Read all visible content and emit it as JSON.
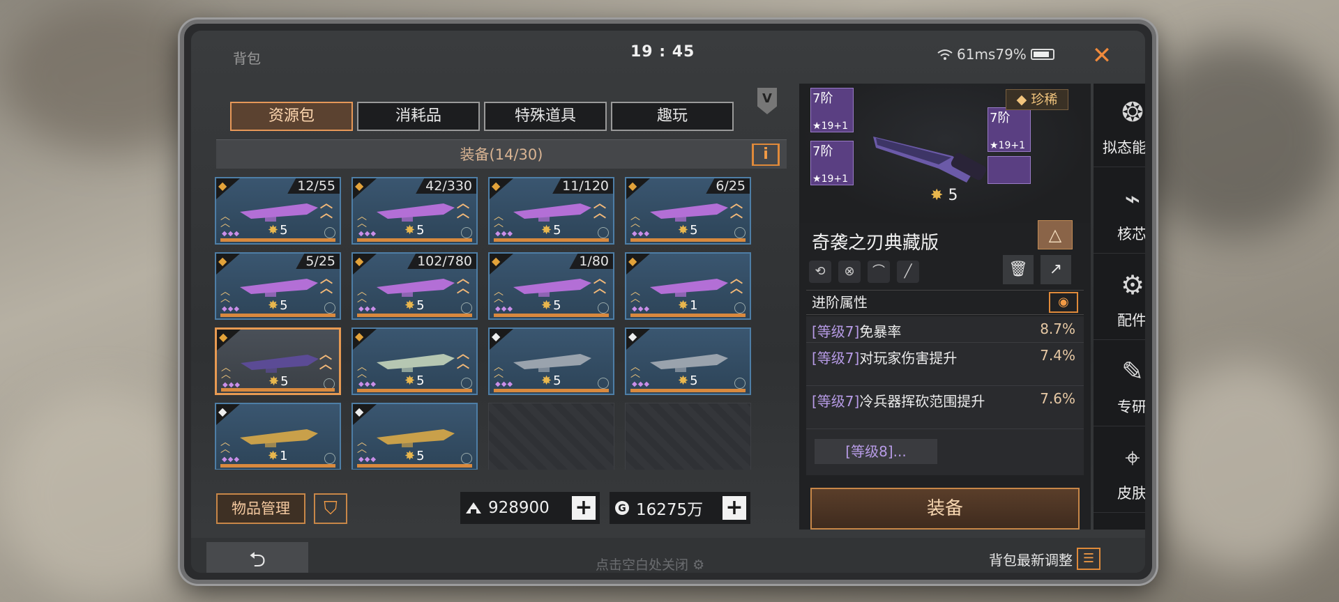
{
  "window": {
    "title": "背包",
    "clock": "19 : 45",
    "status_text": "61ms79%",
    "close_icon": "close-icon",
    "accent_color": "#e08a3a"
  },
  "tabs": [
    {
      "label": "资源包",
      "active": true
    },
    {
      "label": "消耗品",
      "active": false
    },
    {
      "label": "特殊道具",
      "active": false
    },
    {
      "label": "趣玩",
      "active": false
    }
  ],
  "equip_header": "装备(14/30)",
  "grid_items": [
    {
      "count": "12/55",
      "stars": "5",
      "kind": "weapon"
    },
    {
      "count": "42/330",
      "stars": "5",
      "kind": "weapon"
    },
    {
      "count": "11/120",
      "stars": "5",
      "kind": "weapon"
    },
    {
      "count": "6/25",
      "stars": "5",
      "kind": "weapon"
    },
    {
      "count": "5/25",
      "stars": "5",
      "kind": "weapon"
    },
    {
      "count": "102/780",
      "stars": "5",
      "kind": "weapon"
    },
    {
      "count": "1/80",
      "stars": "5",
      "kind": "weapon"
    },
    {
      "count": "",
      "stars": "1",
      "kind": "weapon"
    },
    {
      "count": "",
      "stars": "5",
      "kind": "knife",
      "selected": true
    },
    {
      "count": "",
      "stars": "5",
      "kind": "blade"
    },
    {
      "count": "",
      "stars": "5",
      "kind": "character"
    },
    {
      "count": "",
      "stars": "5",
      "kind": "character"
    },
    {
      "count": "",
      "stars": "1",
      "kind": "armor"
    },
    {
      "count": "",
      "stars": "5",
      "kind": "armor"
    }
  ],
  "bottom_controls": {
    "manage_label": "物品管理",
    "filter_icon": "filter-icon",
    "currency1": "928900",
    "currency2": "16275万"
  },
  "footer": {
    "hint": "点击空白处关闭",
    "latest": "背包最新调整"
  },
  "detail": {
    "rarity": "珍稀",
    "tier_label": "7阶",
    "tier_level": "19+1",
    "stars": "5",
    "name": "奇袭之刃典藏版",
    "attr_title": "进阶属性",
    "attributes": [
      {
        "level": "[等级7]",
        "name": "免暴率",
        "value": "8.7%"
      },
      {
        "level": "[等级7]",
        "name": "对玩家伤害提升",
        "value": "7.4%"
      },
      {
        "level": "[等级7]",
        "name": "冷兵器挥砍范围提升",
        "value": "7.6%"
      }
    ],
    "more": "[等级8]...",
    "equip_button": "装备"
  },
  "sidenav": [
    {
      "label": "拟态能力",
      "icon": "mimic-icon"
    },
    {
      "label": "核芯",
      "icon": "core-icon"
    },
    {
      "label": "配件",
      "icon": "parts-icon"
    },
    {
      "label": "专研",
      "icon": "research-icon"
    },
    {
      "label": "皮肤",
      "icon": "skin-icon"
    }
  ]
}
